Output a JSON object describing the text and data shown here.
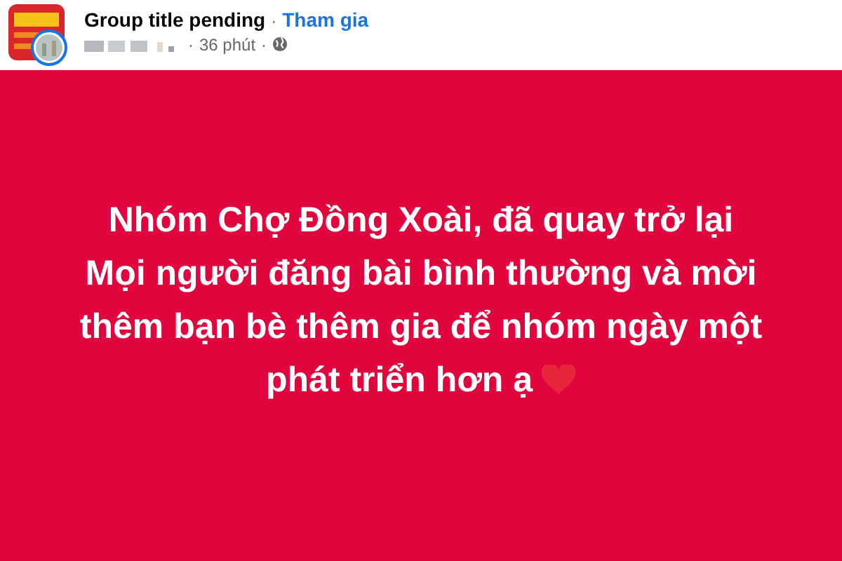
{
  "post_header": {
    "group_title": "Group title pending",
    "separator": "·",
    "join_link": "Tham gia",
    "author_separator": "·",
    "time": "36 phút",
    "time_separator": "·"
  },
  "post_body": {
    "lines": [
      "Nhóm Chợ Đồng Xoài, đã quay trở lại",
      "Mọi người đăng bài bình thường và mời",
      "thêm bạn bè thêm gia để nhóm ngày một",
      "phát triển hơn ạ"
    ],
    "ends_with_heart": true
  }
}
